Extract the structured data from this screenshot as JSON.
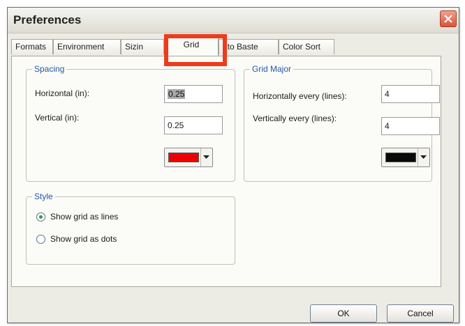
{
  "window": {
    "title": "Preferences"
  },
  "tabs": [
    {
      "label": "Formats"
    },
    {
      "label": "Environment"
    },
    {
      "label": "Sizin"
    },
    {
      "label": "Grid"
    },
    {
      "label": "uto Baste"
    },
    {
      "label": "Color Sort"
    }
  ],
  "active_tab": "Grid",
  "spacing": {
    "title": "Spacing",
    "horizontal_label": "Horizontal (in):",
    "horizontal_value": "0.25",
    "vertical_label": "Vertical (in):",
    "vertical_value": "0.25",
    "color": "#ee0000"
  },
  "grid_major": {
    "title": "Grid Major",
    "horizontal_label": "Horizontally every (lines):",
    "horizontal_value": "4",
    "vertical_label": "Vertically every (lines):",
    "vertical_value": "4",
    "color": "#0a0a0a"
  },
  "style": {
    "title": "Style",
    "options": [
      {
        "label": "Show grid as lines",
        "selected": true
      },
      {
        "label": "Show grid as dots",
        "selected": false
      }
    ]
  },
  "buttons": {
    "ok": "OK",
    "cancel": "Cancel"
  },
  "icons": {
    "close": "close-icon",
    "dropdown": "chevron-down-icon"
  },
  "accent": {
    "highlight": "#ee3b1b",
    "group_label": "#2458a8"
  }
}
